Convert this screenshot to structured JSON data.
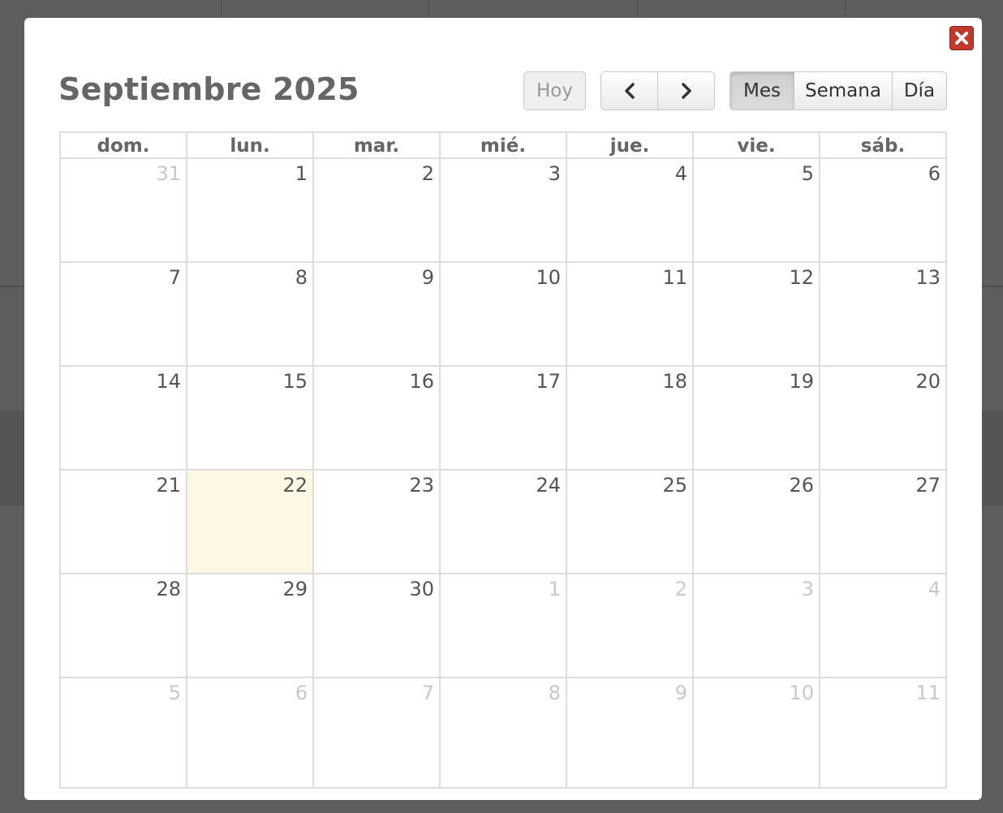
{
  "window": {
    "close_label": "×"
  },
  "calendar": {
    "title": "Septiembre 2025",
    "buttons": {
      "today": "Hoy",
      "prev": "‹",
      "next": "›",
      "month": "Mes",
      "week": "Semana",
      "day": "Día"
    },
    "active_view": "Mes",
    "weekdays": [
      "dom.",
      "lun.",
      "mar.",
      "mié.",
      "jue.",
      "vie.",
      "sáb."
    ],
    "weeks": [
      [
        {
          "d": "31",
          "other": true
        },
        {
          "d": "1"
        },
        {
          "d": "2"
        },
        {
          "d": "3"
        },
        {
          "d": "4"
        },
        {
          "d": "5"
        },
        {
          "d": "6"
        }
      ],
      [
        {
          "d": "7"
        },
        {
          "d": "8"
        },
        {
          "d": "9"
        },
        {
          "d": "10"
        },
        {
          "d": "11"
        },
        {
          "d": "12"
        },
        {
          "d": "13"
        }
      ],
      [
        {
          "d": "14"
        },
        {
          "d": "15"
        },
        {
          "d": "16"
        },
        {
          "d": "17"
        },
        {
          "d": "18"
        },
        {
          "d": "19"
        },
        {
          "d": "20"
        }
      ],
      [
        {
          "d": "21"
        },
        {
          "d": "22",
          "today": true
        },
        {
          "d": "23"
        },
        {
          "d": "24"
        },
        {
          "d": "25"
        },
        {
          "d": "26"
        },
        {
          "d": "27"
        }
      ],
      [
        {
          "d": "28"
        },
        {
          "d": "29"
        },
        {
          "d": "30"
        },
        {
          "d": "1",
          "other": true
        },
        {
          "d": "2",
          "other": true
        },
        {
          "d": "3",
          "other": true
        },
        {
          "d": "4",
          "other": true
        }
      ],
      [
        {
          "d": "5",
          "other": true
        },
        {
          "d": "6",
          "other": true
        },
        {
          "d": "7",
          "other": true
        },
        {
          "d": "8",
          "other": true
        },
        {
          "d": "9",
          "other": true
        },
        {
          "d": "10",
          "other": true
        },
        {
          "d": "11",
          "other": true
        }
      ]
    ]
  },
  "colors": {
    "today_highlight": "#fcf8e3",
    "close_button": "#c0392b",
    "overlay": "#5e5e5e"
  }
}
